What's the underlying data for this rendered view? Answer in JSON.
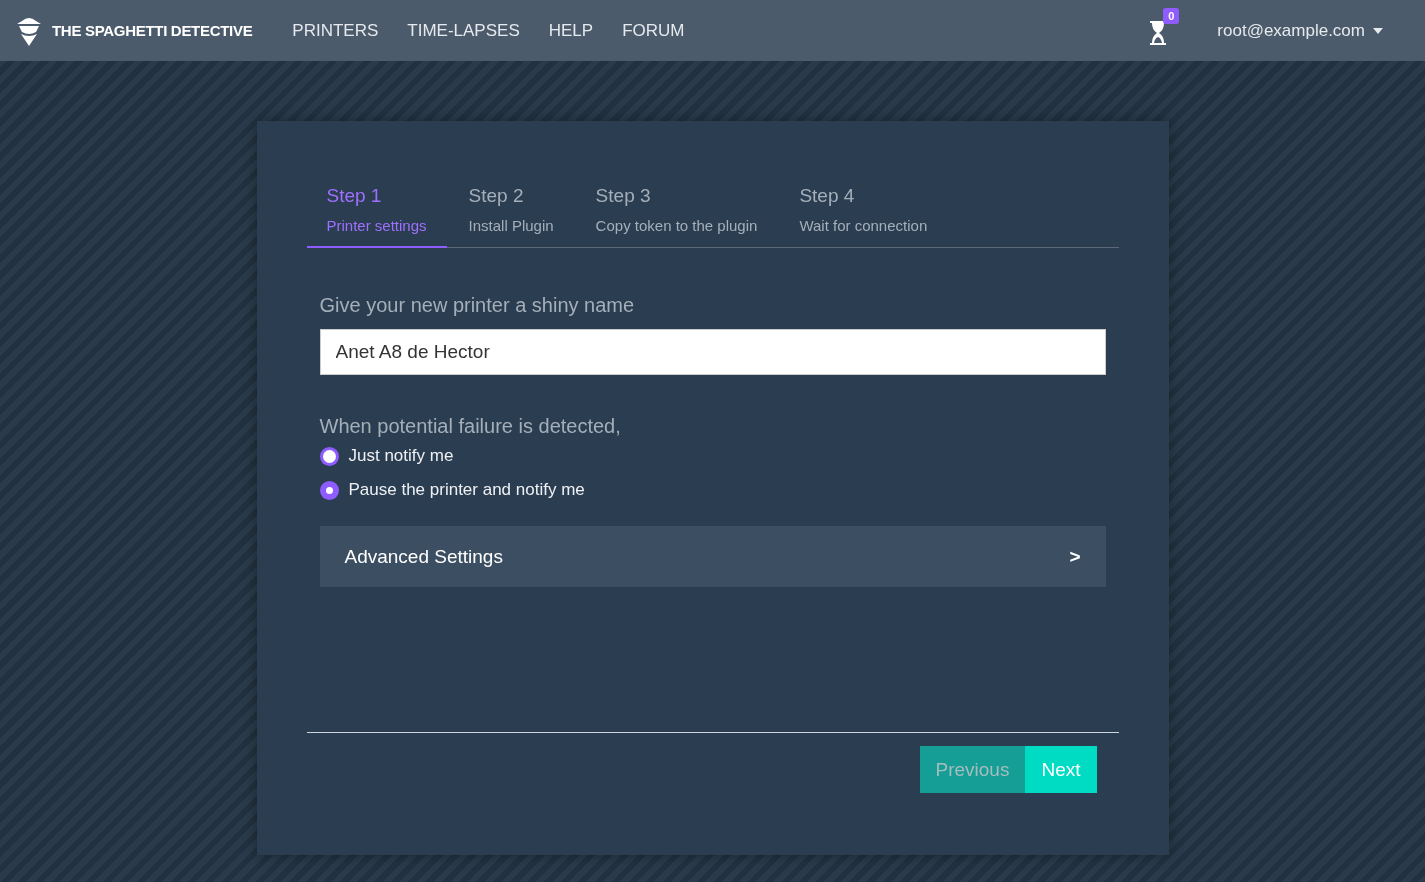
{
  "navbar": {
    "brand": "THE SPAGHETTI DETECTIVE",
    "links": [
      "PRINTERS",
      "TIME-LAPSES",
      "HELP",
      "FORUM"
    ],
    "notification_count": "0",
    "user": "root@example.com"
  },
  "steps": [
    {
      "title": "Step 1",
      "subtitle": "Printer settings",
      "selected": true
    },
    {
      "title": "Step 2",
      "subtitle": "Install Plugin",
      "selected": false
    },
    {
      "title": "Step 3",
      "subtitle": "Copy token to the plugin",
      "selected": false
    },
    {
      "title": "Step 4",
      "subtitle": "Wait for connection",
      "selected": false
    }
  ],
  "name_label": "Give your new printer a shiny name",
  "name_value": "Anet A8 de Hector",
  "failure_label": "When potential failure is detected,",
  "failure_options": [
    {
      "label": "Just notify me",
      "selected": false
    },
    {
      "label": "Pause the printer and notify me",
      "selected": true
    }
  ],
  "advanced": {
    "label": "Advanced Settings",
    "toggle": ">",
    "expanded": false
  },
  "buttons": [
    {
      "label": "Previous",
      "disabled": true
    },
    {
      "label": "Next",
      "disabled": false
    }
  ]
}
